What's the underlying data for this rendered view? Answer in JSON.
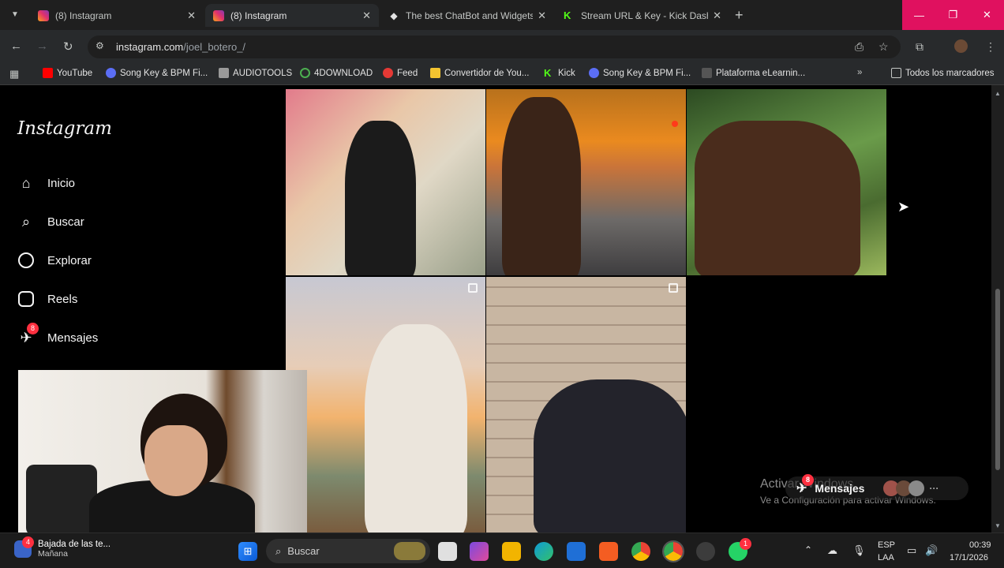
{
  "browser": {
    "tabs": [
      {
        "title": "(8) Instagram",
        "favicon": "instagram-icon",
        "active": false
      },
      {
        "title": "(8) Instagram",
        "favicon": "instagram-icon",
        "active": true
      },
      {
        "title": "The best ChatBot and Widgets f",
        "favicon": "diamond-icon",
        "active": false
      },
      {
        "title": "Stream URL & Key - Kick Dashb",
        "favicon": "kick-icon",
        "active": false
      }
    ],
    "url_host": "instagram.com",
    "url_path": "/joel_botero_/",
    "bookmarks": [
      {
        "label": "YouTube"
      },
      {
        "label": "Song Key & BPM Fi..."
      },
      {
        "label": "AUDIOTOOLS"
      },
      {
        "label": "4DOWNLOAD"
      },
      {
        "label": "Feed"
      },
      {
        "label": "Convertidor de You..."
      },
      {
        "label": "Kick"
      },
      {
        "label": "Song Key & BPM Fi..."
      },
      {
        "label": "Plataforma eLearnin..."
      }
    ],
    "all_bookmarks": "Todos los marcadores"
  },
  "instagram": {
    "logo": "Instagram",
    "nav": [
      {
        "label": "Inicio",
        "icon": "home-icon"
      },
      {
        "label": "Buscar",
        "icon": "search-icon"
      },
      {
        "label": "Explorar",
        "icon": "compass-icon"
      },
      {
        "label": "Reels",
        "icon": "reels-icon"
      },
      {
        "label": "Mensajes",
        "icon": "messenger-icon",
        "badge": "8"
      }
    ],
    "messages_pill": {
      "label": "Mensajes",
      "badge": "8"
    }
  },
  "watermark": {
    "line1": "Activar Windows",
    "line2": "Ve a Configuración para activar Windows."
  },
  "taskbar": {
    "weather_title": "Bajada de las te...",
    "weather_sub": "Mañana",
    "weather_badge": "4",
    "search_placeholder": "Buscar",
    "whatsapp_badge": "1",
    "language": "ESP",
    "language_sub": "LAA",
    "time": "00:39",
    "date": "17/1/2026"
  }
}
